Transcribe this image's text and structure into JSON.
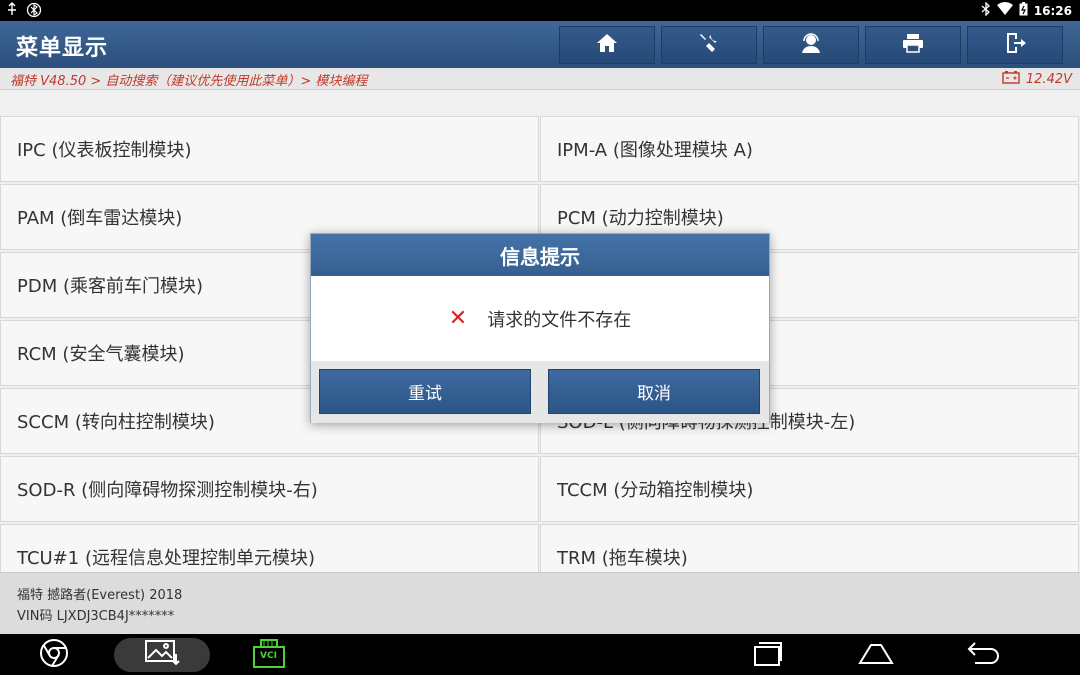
{
  "status_bar": {
    "left_icons": [
      "usb-debug-icon",
      "bluetooth-share-icon"
    ],
    "right_icons": [
      "bluetooth-icon",
      "wifi-icon",
      "battery-icon"
    ],
    "time": "16:26"
  },
  "header": {
    "title": "菜单显示",
    "buttons": [
      "home-icon",
      "diagnose-tools-icon",
      "support-person-icon",
      "print-icon",
      "exit-icon"
    ]
  },
  "breadcrumb": {
    "path": "福特 V48.50 > 自动搜索（建议优先使用此菜单）> 模块编程",
    "voltage": "12.42V"
  },
  "modules": [
    [
      "IPC (仪表板控制模块)",
      "IPM-A (图像处理模块 A)"
    ],
    [
      "PAM (倒车雷达模块)",
      "PCM (动力控制模块)"
    ],
    [
      "PDM (乘客前车门模块)",
      ")"
    ],
    [
      "RCM (安全气囊模块)",
      ""
    ],
    [
      "SCCM (转向柱控制模块)",
      "SOD-L (侧向障碍物探测控制模块-左)"
    ],
    [
      "SOD-R (侧向障碍物探测控制模块-右)",
      "TCCM (分动箱控制模块)"
    ],
    [
      "TCU#1 (远程信息处理控制单元模块)",
      "TRM (拖车模块)"
    ]
  ],
  "footer": {
    "vehicle": "福特 撼路者(Everest) 2018",
    "vin": "VIN码 LJXDJ3CB4J*******"
  },
  "dialog": {
    "title": "信息提示",
    "message": "请求的文件不存在",
    "retry_label": "重试",
    "cancel_label": "取消"
  },
  "navbar": {
    "left_icons": [
      "chrome-icon",
      "gallery-icon",
      "vci-icon"
    ],
    "vci_label": "VCI",
    "right_icons": [
      "recent-apps-icon",
      "home-nav-icon",
      "back-icon"
    ]
  }
}
